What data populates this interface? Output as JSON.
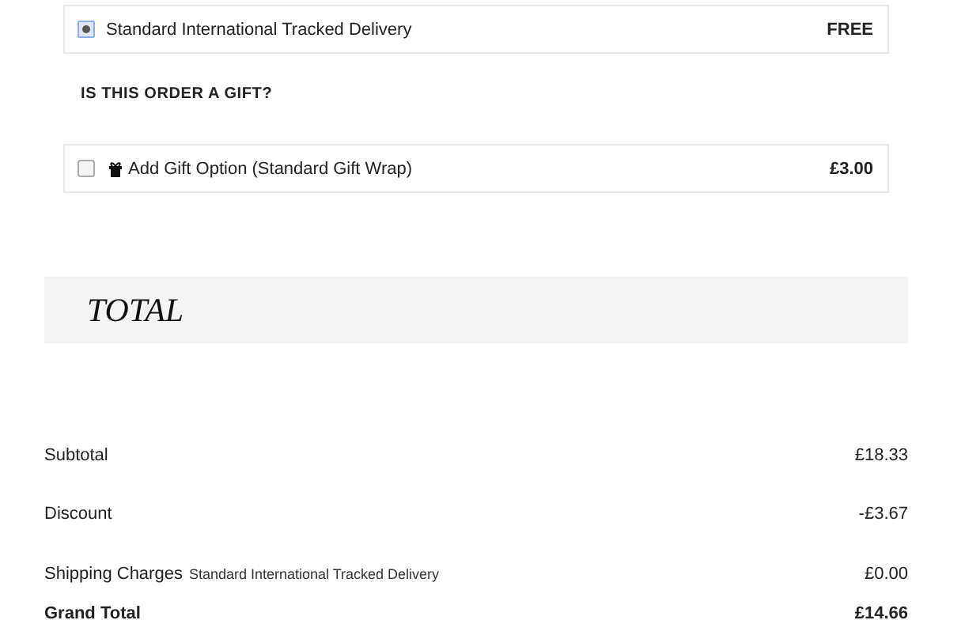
{
  "delivery_options": [
    {
      "label": "Standard International Tracked Delivery",
      "price": "FREE",
      "selected": true
    }
  ],
  "gift": {
    "heading": "IS THIS ORDER A GIFT?",
    "option": {
      "label": "Add Gift Option (Standard Gift Wrap)",
      "price": "£3.00",
      "checked": false
    }
  },
  "total": {
    "heading": "TOTAL",
    "rows": [
      {
        "label": "Subtotal",
        "amount": "£18.33"
      },
      {
        "label": "Discount",
        "amount": "-£3.67"
      },
      {
        "label": "Shipping Charges",
        "note": "Standard International Tracked Delivery",
        "amount": "£0.00"
      },
      {
        "label": "Grand Total",
        "amount": "£14.66",
        "kind": "grand"
      }
    ]
  }
}
